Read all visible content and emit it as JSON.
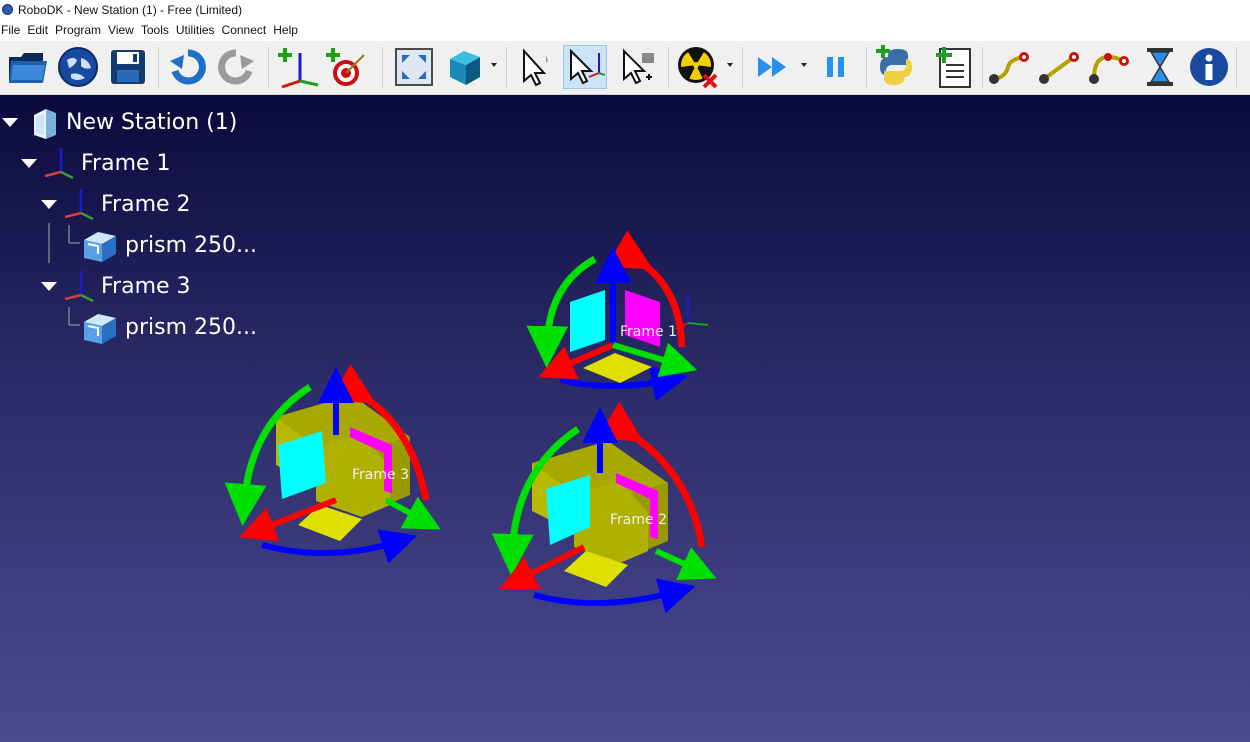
{
  "window": {
    "title": "RoboDK - New Station (1) - Free (Limited)"
  },
  "menu": [
    "File",
    "Edit",
    "Program",
    "View",
    "Tools",
    "Utilities",
    "Connect",
    "Help"
  ],
  "toolbar": [
    {
      "name": "open-icon"
    },
    {
      "name": "online-library-icon"
    },
    {
      "name": "save-icon"
    },
    {
      "name": "undo-icon"
    },
    {
      "name": "redo-icon"
    },
    {
      "name": "add-reference-frame-icon"
    },
    {
      "name": "add-target-icon"
    },
    {
      "name": "fit-all-icon"
    },
    {
      "name": "view-cube-icon"
    },
    {
      "name": "select-icon"
    },
    {
      "name": "move-reference-frame-icon"
    },
    {
      "name": "move-tool-icon"
    },
    {
      "name": "collision-check-icon"
    },
    {
      "name": "fast-simulation-icon"
    },
    {
      "name": "pause-icon"
    },
    {
      "name": "python-program-icon"
    },
    {
      "name": "add-program-icon"
    },
    {
      "name": "joint-move-icon"
    },
    {
      "name": "linear-move-icon"
    },
    {
      "name": "circular-move-icon"
    },
    {
      "name": "pause-instruction-icon"
    },
    {
      "name": "info-icon"
    }
  ],
  "tree": {
    "station": "New Station (1)",
    "frame1": "Frame 1",
    "frame2": "Frame 2",
    "prism_a": "prism 250...",
    "frame3": "Frame 3",
    "prism_b": "prism 250..."
  },
  "scene": {
    "frame1_label": "Frame 1",
    "frame2_label": "Frame 2",
    "frame3_label": "Frame 3"
  },
  "colors": {
    "x_axis": "#ff0000",
    "y_axis": "#00e000",
    "z_axis": "#0000ff",
    "plane_xy": "#e0e000",
    "plane_yz": "#00ffff",
    "plane_xz": "#ff00ff",
    "prism": "#a8a800"
  }
}
